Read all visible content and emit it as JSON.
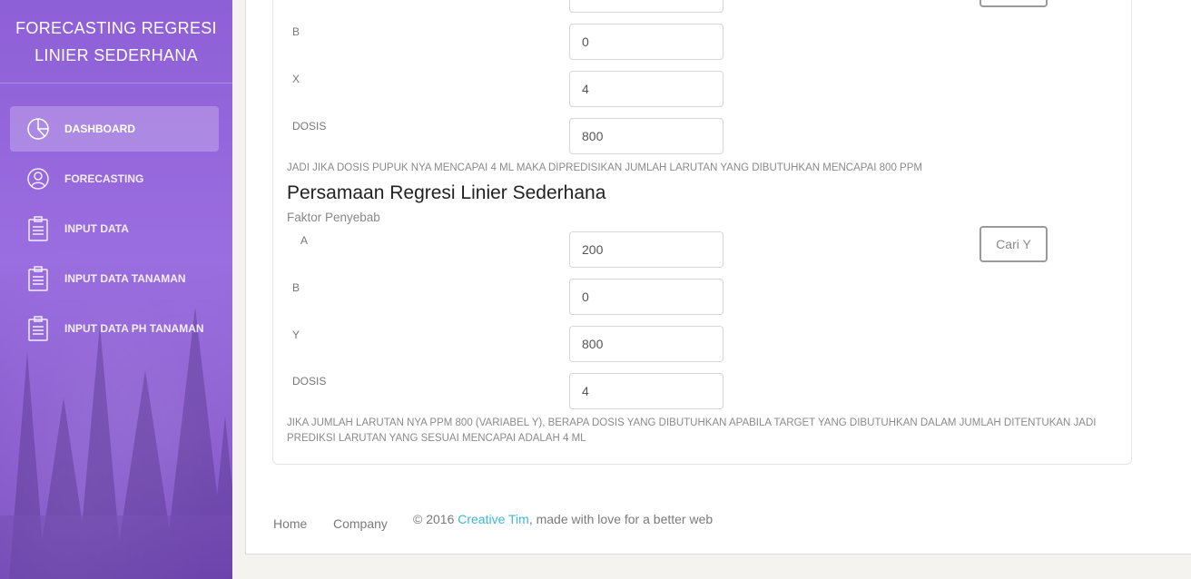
{
  "brand": {
    "line1": "FORECASTING REGRESI",
    "line2": "LINIER SEDERHANA"
  },
  "sidebar": {
    "items": [
      {
        "label": "DASHBOARD",
        "icon": "pie-chart-icon",
        "active": true
      },
      {
        "label": "FORECASTING",
        "icon": "user-icon",
        "active": false
      },
      {
        "label": "INPUT DATA",
        "icon": "clipboard-icon",
        "active": false
      },
      {
        "label": "INPUT DATA TANAMAN",
        "icon": "clipboard-icon",
        "active": false
      },
      {
        "label": "INPUT DATA PH TANAMAN",
        "icon": "clipboard-icon",
        "active": false
      }
    ]
  },
  "section1": {
    "fields": [
      {
        "label": "B",
        "value": "0"
      },
      {
        "label": "X",
        "value": "4"
      },
      {
        "label": "DOSIS",
        "value": "800"
      }
    ],
    "note": "JADI JIKA DOSIS PUPUK NYA MENCAPAI 4 ML MAKA DIPREDISIKAN JUMLAH LARUTAN YANG DIBUTUHKAN MENCAPAI 800 PPM"
  },
  "section2": {
    "title": "Persamaan Regresi Linier Sederhana",
    "subtitle": "Faktor Penyebab",
    "button": "Cari Y",
    "fields": [
      {
        "label": "A",
        "value": "200"
      },
      {
        "label": "B",
        "value": "0"
      },
      {
        "label": "Y",
        "value": "800"
      },
      {
        "label": "DOSIS",
        "value": "4"
      }
    ],
    "note_line1": "JIKA JUMLAH LARUTAN NYA PPM 800 (VARIABEL Y), BERAPA DOSIS YANG DIBUTUHKAN APABILA TARGET YANG DIBUTUHKAN DALAM JUMLAH DITENTUKAN JADI",
    "note_line2": "PREDIKSI LARUTAN YANG SESUAI MENCAPAI ADALAH 4 ML"
  },
  "footer": {
    "links": [
      "Home",
      "Company"
    ],
    "copy_prefix": "© 2016 ",
    "copy_link": "Creative Tim",
    "copy_suffix": ", made with love for a better web"
  }
}
